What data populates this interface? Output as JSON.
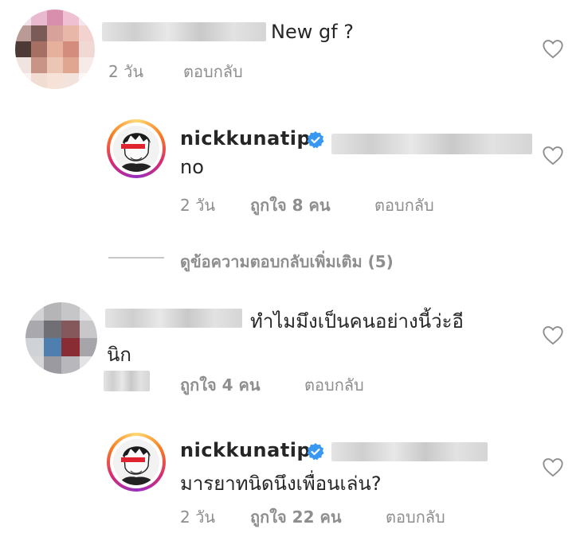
{
  "comments": [
    {
      "text": "New gf ?",
      "time": "2 วัน",
      "reply": "ตอบกลับ"
    },
    {
      "username": "nickkunatip",
      "text": "no",
      "time": "2 วัน",
      "likes": "ถูกใจ 8 คน",
      "reply": "ตอบกลับ"
    },
    {
      "text_line1": "ทำไมมึงเป็นคนอย่างนี้ว่ะอี",
      "text_line2": "นิก",
      "likes": "ถูกใจ 4 คน",
      "reply": "ตอบกลับ"
    },
    {
      "username": "nickkunatip",
      "text": "มารยาทนิดนึงเพื่อนเล่น?",
      "time": "2 วัน",
      "likes": "ถูกใจ 22 คน",
      "reply": "ตอบกลับ"
    }
  ],
  "view_more_replies": "ดูข้อความตอบกลับเพิ่มเติม (5)",
  "icons": {
    "like": "heart-outline-icon",
    "verified": "verified-badge-icon"
  },
  "colors": {
    "verified_blue": "#3897f0",
    "meta_gray": "#8e8e8e",
    "text": "#262626"
  }
}
